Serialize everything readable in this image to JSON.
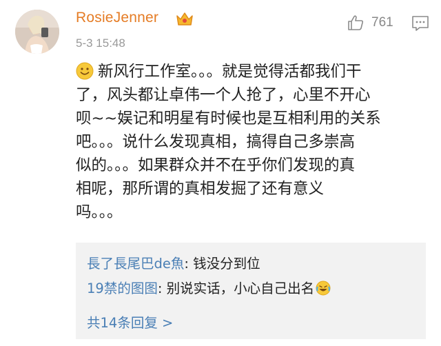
{
  "post": {
    "username": "RosieJenner",
    "badge_icon": "crown-icon",
    "timestamp": "5-3 15:48",
    "like_count": "761",
    "body_lines": [
      "新风行工作室。。。就是觉得活都我们干",
      "了，风头都让卓伟一个人抢了，心里不开心",
      "呗~~娱记和明星有时候也是互相利用的关系",
      "吧。。。说什么发现真相，搞得自己多崇高",
      "似的。。。如果群众并不在乎你们发现的真",
      "相呢，那所谓的真相发掘了还有意义",
      "吗。。。"
    ]
  },
  "replies": {
    "items": [
      {
        "author": "長了長尾巴de魚",
        "text": ": 钱没分到位"
      },
      {
        "author": "19禁的图图",
        "text": ": 别说实话，小心自己出名"
      }
    ],
    "more_label": "共14条回复 >"
  },
  "colors": {
    "username": "#e57c25",
    "link": "#4a7fb5",
    "meta": "#999999",
    "reply_bg": "#f2f2f2"
  }
}
